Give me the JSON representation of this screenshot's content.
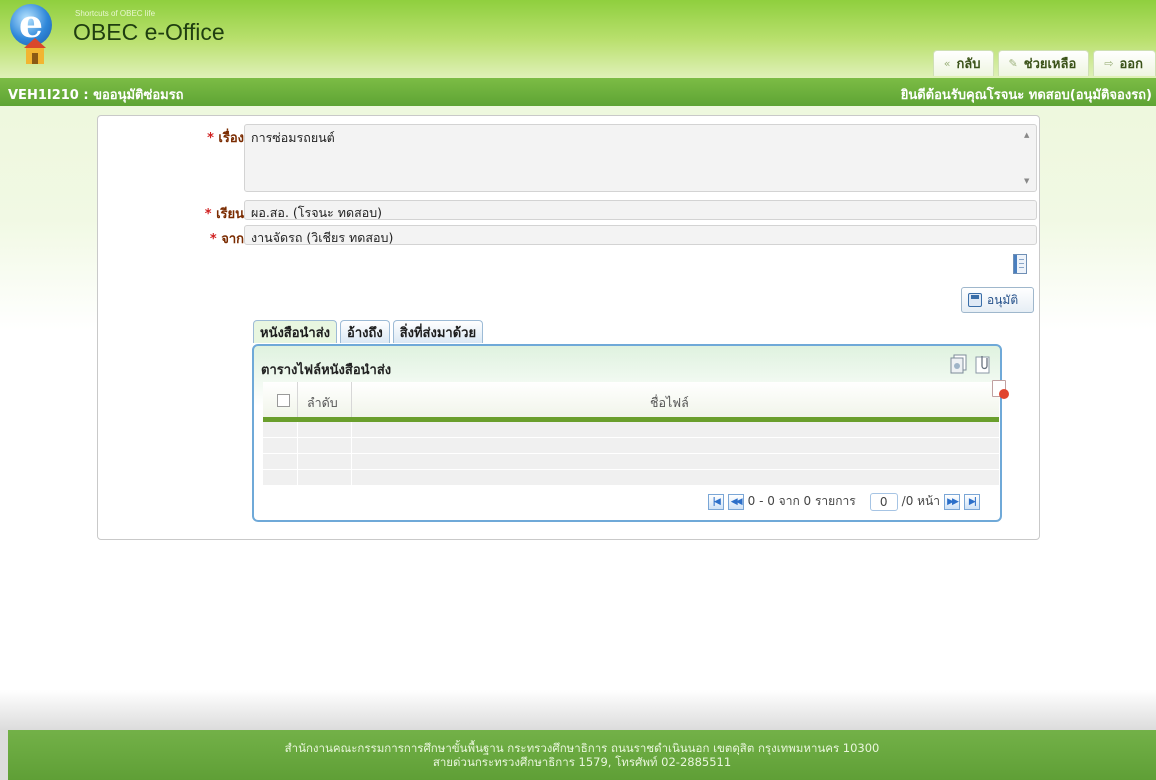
{
  "header": {
    "tagline": "Shortcuts of OBEC life",
    "app_name": "OBEC e-Office",
    "nav": [
      {
        "label": "กลับ",
        "icon": "back-arrow-icon"
      },
      {
        "label": "ช่วยเหลือ",
        "icon": "help-icon"
      },
      {
        "label": "ออก",
        "icon": "logout-icon"
      }
    ]
  },
  "titlebar": {
    "screen_code": "VEH1I210 : ขออนุมัติซ่อมรถ",
    "welcome": "ยินดีต้อนรับคุณโรจนะ ทดสอบ(อนุมัติจองรถ)"
  },
  "form": {
    "subject": {
      "label": "เรื่อง",
      "required": "*",
      "value": "การซ่อมรถยนต์"
    },
    "to": {
      "label": "เรียน",
      "required": "*",
      "value": "ผอ.สอ. (โรจนะ ทดสอบ)"
    },
    "from": {
      "label": "จาก",
      "required": "*",
      "value": "งานจัดรถ (วิเชียร ทดสอบ)"
    },
    "approve_label": "อนุมัติ"
  },
  "tabs": [
    {
      "label": "หนังสือนำส่ง",
      "active": true
    },
    {
      "label": "อ้างถึง",
      "active": false
    },
    {
      "label": "สิ่งที่ส่งมาด้วย",
      "active": false
    }
  ],
  "file_table": {
    "title": "ตารางไฟล์หนังสือนำส่ง",
    "columns": [
      "ลำดับ",
      "ชื่อไฟล์"
    ],
    "rows": []
  },
  "pager": {
    "range_text": "0 - 0 จาก 0 รายการ",
    "page": "0",
    "page_suffix": "/0 หน้า"
  },
  "footer": {
    "line1": "สำนักงานคณะกรรมการการศึกษาขั้นพื้นฐาน กระทรวงศึกษาธิการ ถนนราชดำเนินนอก เขตดุสิต กรุงเทพมหานคร 10300",
    "line2": "สายด่วนกระทรวงศึกษาธิการ 1579, โทรศัพท์ 02-2885511"
  },
  "colors": {
    "brand_green": "#5ea434",
    "tab_border": "#6fa9d8",
    "label_red": "#7a2b00"
  }
}
